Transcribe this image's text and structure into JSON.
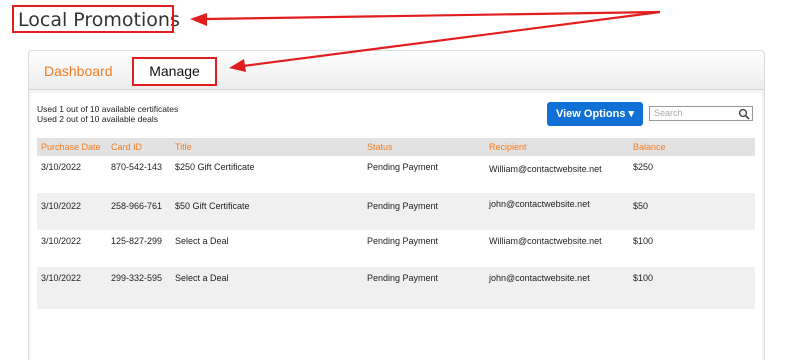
{
  "page": {
    "title": "Local Promotions"
  },
  "tabs": [
    {
      "label": "Dashboard"
    },
    {
      "label": "Manage"
    }
  ],
  "usage": {
    "certificates": "Used 1 out of 10 available certificates",
    "deals": "Used 2 out of 10 available deals"
  },
  "toolbar": {
    "view_options_label": "View Options ▾",
    "search_placeholder": "Search"
  },
  "table": {
    "headers": [
      "Purchase Date",
      "Card ID",
      "Title",
      "Status",
      "Recipient",
      "Balance"
    ],
    "rows": [
      [
        "3/10/2022",
        "870-542-143",
        "$250 Gift Certificate",
        "Pending Payment",
        "William@contactwebsite.net",
        "$250"
      ],
      [
        "3/10/2022",
        "258-966-761",
        "$50 Gift Certificate",
        "Pending Payment",
        "john@contactwebsite.net",
        "$50"
      ],
      [
        "3/10/2022",
        "125-827-299",
        "Select a Deal",
        "Pending Payment",
        "William@contactwebsite.net",
        "$100"
      ],
      [
        "3/10/2022",
        "299-332-595",
        "Select a Deal",
        "Pending Payment",
        "john@contactwebsite.net",
        "$100"
      ]
    ]
  },
  "colors": {
    "accent": "#f47c20",
    "button": "#1170d6",
    "highlight": "#e21d1d"
  }
}
